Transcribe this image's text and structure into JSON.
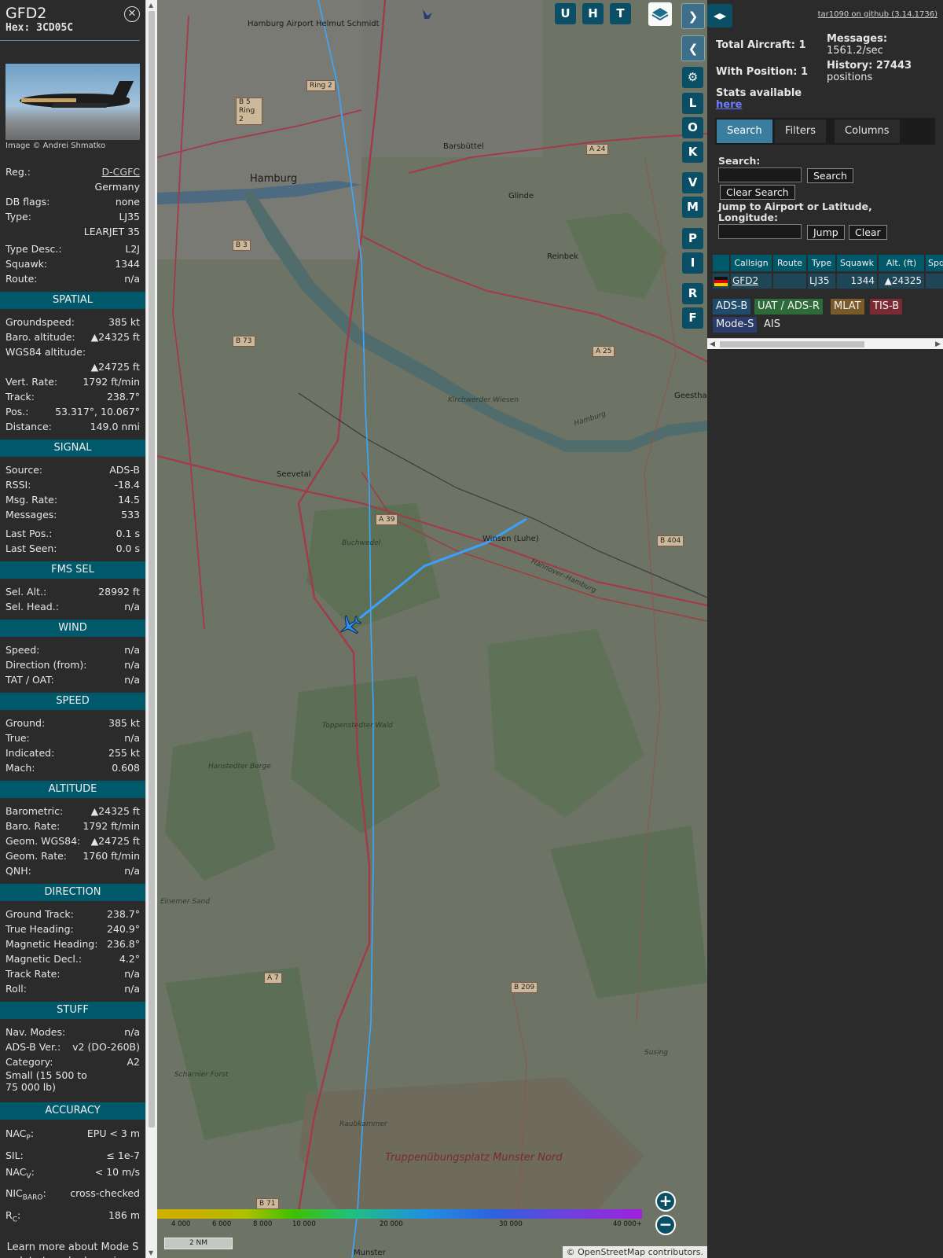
{
  "aircraft": {
    "callsign": "GFD2",
    "hex_line": "Hex: 3CD05C",
    "photo_credit": "Image © Andrei Shmatko",
    "general": [
      {
        "k": "Reg.:",
        "v": "D-CGFC",
        "link": true
      },
      {
        "k": "",
        "v": "Germany"
      },
      {
        "k": "DB flags:",
        "v": "none"
      },
      {
        "k": "Type:",
        "v": "LJ35"
      },
      {
        "k": "",
        "v": "LEARJET 35"
      }
    ],
    "general2": [
      {
        "k": "Type Desc.:",
        "v": "L2J"
      },
      {
        "k": "Squawk:",
        "v": "1344"
      },
      {
        "k": "Route:",
        "v": "n/a"
      }
    ],
    "spatial_title": "SPATIAL",
    "spatial": [
      {
        "k": "Groundspeed:",
        "v": "385 kt"
      },
      {
        "k": "Baro. altitude:",
        "v": "▲24325 ft"
      },
      {
        "k": "WGS84 altitude:",
        "v": ""
      },
      {
        "k": "",
        "v": "▲24725 ft"
      },
      {
        "k": "Vert. Rate:",
        "v": "1792 ft/min"
      },
      {
        "k": "Track:",
        "v": "238.7°"
      },
      {
        "k": "Pos.:",
        "v": "53.317°, 10.067°"
      },
      {
        "k": "Distance:",
        "v": "149.0 nmi"
      }
    ],
    "signal_title": "SIGNAL",
    "signal": [
      {
        "k": "Source:",
        "v": "ADS-B"
      },
      {
        "k": "RSSI:",
        "v": "-18.4"
      },
      {
        "k": "Msg. Rate:",
        "v": "14.5"
      },
      {
        "k": "Messages:",
        "v": "533"
      }
    ],
    "signal2": [
      {
        "k": "Last Pos.:",
        "v": "0.1 s"
      },
      {
        "k": "Last Seen:",
        "v": "0.0 s"
      }
    ],
    "fms_title": "FMS SEL",
    "fms": [
      {
        "k": "Sel. Alt.:",
        "v": "28992 ft"
      },
      {
        "k": "Sel. Head.:",
        "v": "n/a"
      }
    ],
    "wind_title": "WIND",
    "wind": [
      {
        "k": "Speed:",
        "v": "n/a"
      },
      {
        "k": "Direction (from):",
        "v": "n/a"
      },
      {
        "k": "TAT / OAT:",
        "v": "n/a"
      }
    ],
    "speed_title": "SPEED",
    "speed": [
      {
        "k": "Ground:",
        "v": "385 kt"
      },
      {
        "k": "True:",
        "v": "n/a"
      },
      {
        "k": "Indicated:",
        "v": "255 kt"
      },
      {
        "k": "Mach:",
        "v": "0.608"
      }
    ],
    "altitude_title": "ALTITUDE",
    "altitude": [
      {
        "k": "Barometric:",
        "v": "▲24325 ft"
      },
      {
        "k": "Baro. Rate:",
        "v": "1792 ft/min"
      },
      {
        "k": "Geom. WGS84:",
        "v": "▲24725 ft"
      },
      {
        "k": "Geom. Rate:",
        "v": "1760 ft/min"
      },
      {
        "k": "QNH:",
        "v": "n/a"
      }
    ],
    "direction_title": "DIRECTION",
    "direction": [
      {
        "k": "Ground Track:",
        "v": "238.7°"
      },
      {
        "k": "True Heading:",
        "v": "240.9°"
      },
      {
        "k": "Magnetic Heading:",
        "v": "236.8°"
      },
      {
        "k": "Magnetic Decl.:",
        "v": "4.2°"
      },
      {
        "k": "Track Rate:",
        "v": "n/a"
      },
      {
        "k": "Roll:",
        "v": "n/a"
      }
    ],
    "stuff_title": "STUFF",
    "stuff": [
      {
        "k": "Nav. Modes:",
        "v": "n/a"
      },
      {
        "k": "ADS-B Ver.:",
        "v": "v2 (DO-260B)"
      },
      {
        "k": "Category:",
        "v": "A2"
      }
    ],
    "category_desc": "Small (15 500 to 75 000 lb)",
    "accuracy_title": "ACCURACY",
    "accuracy": [
      {
        "k": "NAC",
        "sub": "P",
        "v": "EPU < 3 m"
      },
      {
        "k": "SIL:",
        "sub": "",
        "v": "≤ 1e-7"
      },
      {
        "k": "NAC",
        "sub": "V",
        "v": "< 10 m/s"
      },
      {
        "k": "NIC",
        "sub": "BARO",
        "v": "cross-checked"
      },
      {
        "k": "R",
        "sub": "C",
        "v": "186 m"
      }
    ],
    "footer": "Learn more about Mode S data type by hovering over each data label"
  },
  "map": {
    "buttons": {
      "u": "U",
      "h": "H",
      "t": "T",
      "l": "L",
      "o": "O",
      "k": "K",
      "v": "V",
      "m": "M",
      "p": "P",
      "i": "I",
      "r": "R",
      "f": "F"
    },
    "zoom_in": "+",
    "zoom_out": "−",
    "scale_bar": "2 NM",
    "altitude_scale": [
      "4 000",
      "6 000",
      "8 000",
      "10 000",
      "20 000",
      "30 000",
      "40 000+"
    ],
    "attribution": "© OpenStreetMap contributors.",
    "places": {
      "hamburg": "Hamburg",
      "airport": "Hamburg Airport Helmut Schmidt",
      "barsbuttel": "Barsbüttel",
      "glinde": "Glinde",
      "reinbek": "Reinbek",
      "geesthacht": "Geestha",
      "seevetal": "Seevetal",
      "winsen": "Winsen (Luhe)",
      "buchwedel": "Buchwedel",
      "kirchwerder": "Kirchwerder Wiesen",
      "toppenstedter": "Toppenstedter Wald",
      "hanstedter": "Hanstedter Berge",
      "einemer": "Einemer Sand",
      "scharnier": "Scharnier Forst",
      "raubkammer": "Raubkammer",
      "susing": "Susing",
      "truppen": "Truppenübungsplatz Munster Nord",
      "munster": "Munster",
      "hannover_hamburg": "Hannover–Hamburg",
      "hamburg_road": "Hamburg"
    },
    "shields": {
      "ring2": "Ring 2",
      "b5": "B 5 Ring 2",
      "a24": "A 24",
      "b3": "B 3",
      "b73": "B 73",
      "a25": "A 25",
      "a39": "A 39",
      "b404": "B 404",
      "a7": "A 7",
      "b209": "B 209",
      "b71": "B 71"
    }
  },
  "right": {
    "github": "tar1090 on github (3.14.1736)",
    "total_aircraft": "Total Aircraft: 1",
    "with_position": "With Position: 1",
    "messages_label": "Messages:",
    "messages_value": "1561.2/sec",
    "history_label": "History: 27443",
    "history_value": "positions",
    "stats_text": "Stats available",
    "stats_link": "here",
    "tabs": [
      "Search",
      "Filters",
      "Columns"
    ],
    "search_label": "Search:",
    "search_button": "Search",
    "clear_search": "Clear Search",
    "jump_label": "Jump to Airport or Latitude, Longitude:",
    "jump_button": "Jump",
    "clear_button": "Clear",
    "columns": [
      "Callsign",
      "Route",
      "Type",
      "Squawk",
      "Alt. (ft)",
      "Spd"
    ],
    "row": {
      "callsign": "GFD2",
      "route": "",
      "type": "LJ35",
      "squawk": "1344",
      "alt": "▲24325"
    },
    "chips": [
      {
        "label": "ADS-B",
        "color": "#1e4c6a"
      },
      {
        "label": "UAT / ADS-R",
        "color": "#2f6b3a"
      },
      {
        "label": "MLAT",
        "color": "#7a5a2a"
      },
      {
        "label": "TIS-B",
        "color": "#7a2a33"
      },
      {
        "label": "Mode-S",
        "color": "#2a3c6a"
      },
      {
        "label": "AIS",
        "color": "#2b2b2b"
      }
    ]
  }
}
